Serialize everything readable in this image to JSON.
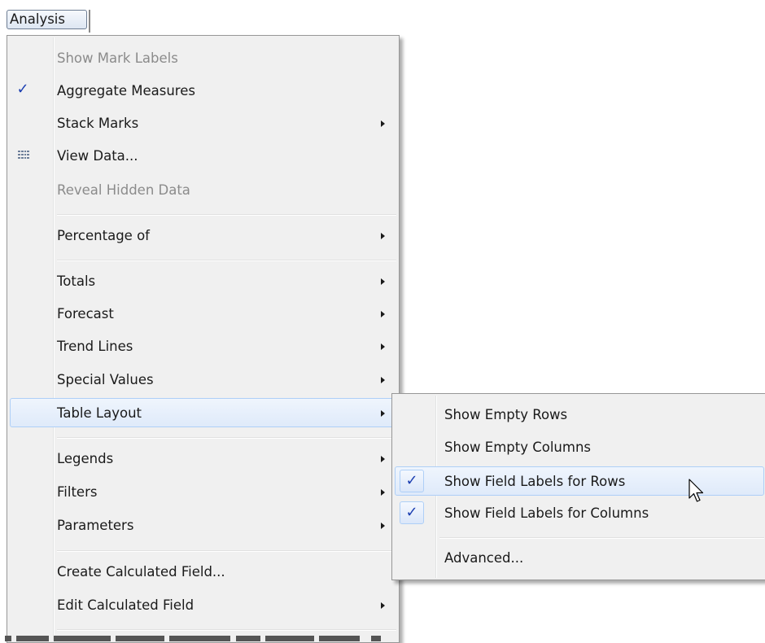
{
  "menubar": {
    "analysis_label": "Analysis"
  },
  "analysis_menu": {
    "items": [
      {
        "label": "Show Mark Labels",
        "disabled": true
      },
      {
        "label": "Aggregate Measures",
        "checked": true
      },
      {
        "label": "Stack Marks",
        "submenu": true
      },
      {
        "label": "View Data...",
        "icon": "table-icon"
      },
      {
        "label": "Reveal Hidden Data",
        "disabled": true
      },
      {
        "label": "Percentage of",
        "submenu": true
      },
      {
        "label": "Totals",
        "submenu": true
      },
      {
        "label": "Forecast",
        "submenu": true
      },
      {
        "label": "Trend Lines",
        "submenu": true
      },
      {
        "label": "Special Values",
        "submenu": true
      },
      {
        "label": "Table Layout",
        "submenu": true,
        "highlighted": true
      },
      {
        "label": "Legends",
        "submenu": true
      },
      {
        "label": "Filters",
        "submenu": true
      },
      {
        "label": "Parameters",
        "submenu": true
      },
      {
        "label": "Create Calculated Field..."
      },
      {
        "label": "Edit Calculated Field",
        "submenu": true
      }
    ]
  },
  "table_layout_submenu": {
    "items": [
      {
        "label": "Show Empty Rows"
      },
      {
        "label": "Show Empty Columns"
      },
      {
        "label": "Show Field Labels for Rows",
        "checked": true,
        "highlighted": true
      },
      {
        "label": "Show Field Labels for Columns",
        "checked": true
      },
      {
        "label": "Advanced..."
      }
    ]
  },
  "colors": {
    "check": "#1c3fb1",
    "highlight_border": "#aecff7",
    "menu_bg": "#f0f0f0"
  }
}
